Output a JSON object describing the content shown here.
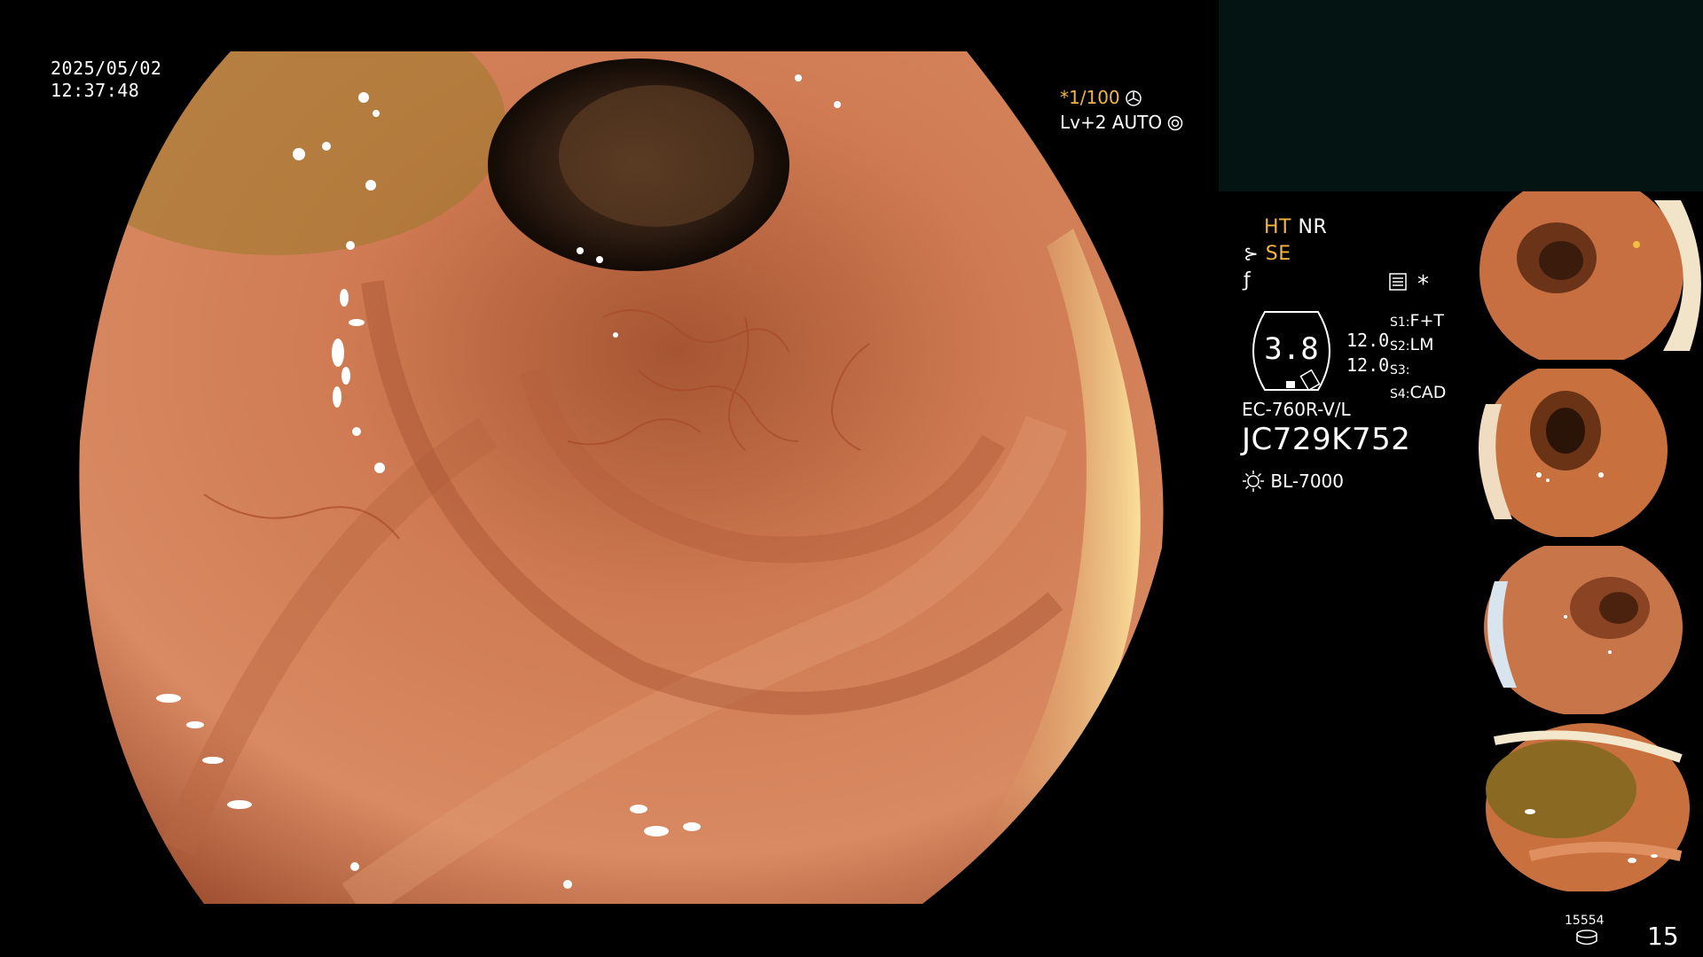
{
  "overlay": {
    "date": "2025/05/02",
    "time": "12:37:48",
    "shutter": "*1/100",
    "level": "Lv+2",
    "auto": "AUTO"
  },
  "status": {
    "ht": "HT",
    "nr": "NR",
    "se": "SE",
    "star": "*",
    "zoom": "3.8",
    "value1": "12.0",
    "value2": "12.0",
    "s1_label": "S1:",
    "s1_value": "F+T",
    "s2_label": "S2:",
    "s2_value": "LM",
    "s3_label": "S3:",
    "s3_value": "",
    "s4_label": "S4:",
    "s4_value": "CAD",
    "scope_model": "EC-760R-V/L",
    "serial": "JC729K752",
    "light_source": "BL-7000"
  },
  "footer": {
    "count_small": "15554",
    "count_large": "15"
  },
  "colors": {
    "accent_yellow": "#f2b640",
    "tissue": "#c8704a",
    "panel_teal": "#031412"
  },
  "icons": [
    "fan-icon",
    "gear-icon",
    "scissors-icon",
    "sharpness-icon",
    "filter-icon",
    "sun-icon",
    "cylinder-icon"
  ]
}
